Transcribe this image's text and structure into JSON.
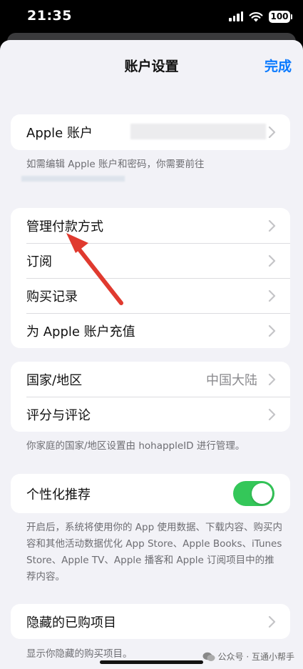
{
  "status_bar": {
    "time": "21:35",
    "battery": "100"
  },
  "nav": {
    "title": "账户设置",
    "done": "完成"
  },
  "apple_account": {
    "label": "Apple 账户",
    "footer": "如需编辑 Apple 账户和密码，你需要前往"
  },
  "payment_group": [
    {
      "label": "管理付款方式"
    },
    {
      "label": "订阅"
    },
    {
      "label": "购买记录"
    },
    {
      "label": "为 Apple 账户充值"
    }
  ],
  "region_group": {
    "country_label": "国家/地区",
    "country_value": "中国大陆",
    "ratings_label": "评分与评论",
    "footer": "你家庭的国家/地区设置由 hohappleID 进行管理。"
  },
  "personalization": {
    "label": "个性化推荐",
    "toggle_on": true,
    "footer": "开启后，系统将使用你的 App 使用数据、下载内容、购买内容和其他活动数据优化 App Store、Apple Books、iTunes Store、Apple TV、Apple 播客和 Apple 订阅项目中的推荐内容。"
  },
  "hidden_purchases": {
    "label": "隐藏的已购项目",
    "footer": "显示你隐藏的购买项目。"
  },
  "watermark": "公众号 · 互通小帮手",
  "colors": {
    "accent": "#0a7aff",
    "toggle": "#34c759",
    "arrow": "#e03a2f"
  }
}
